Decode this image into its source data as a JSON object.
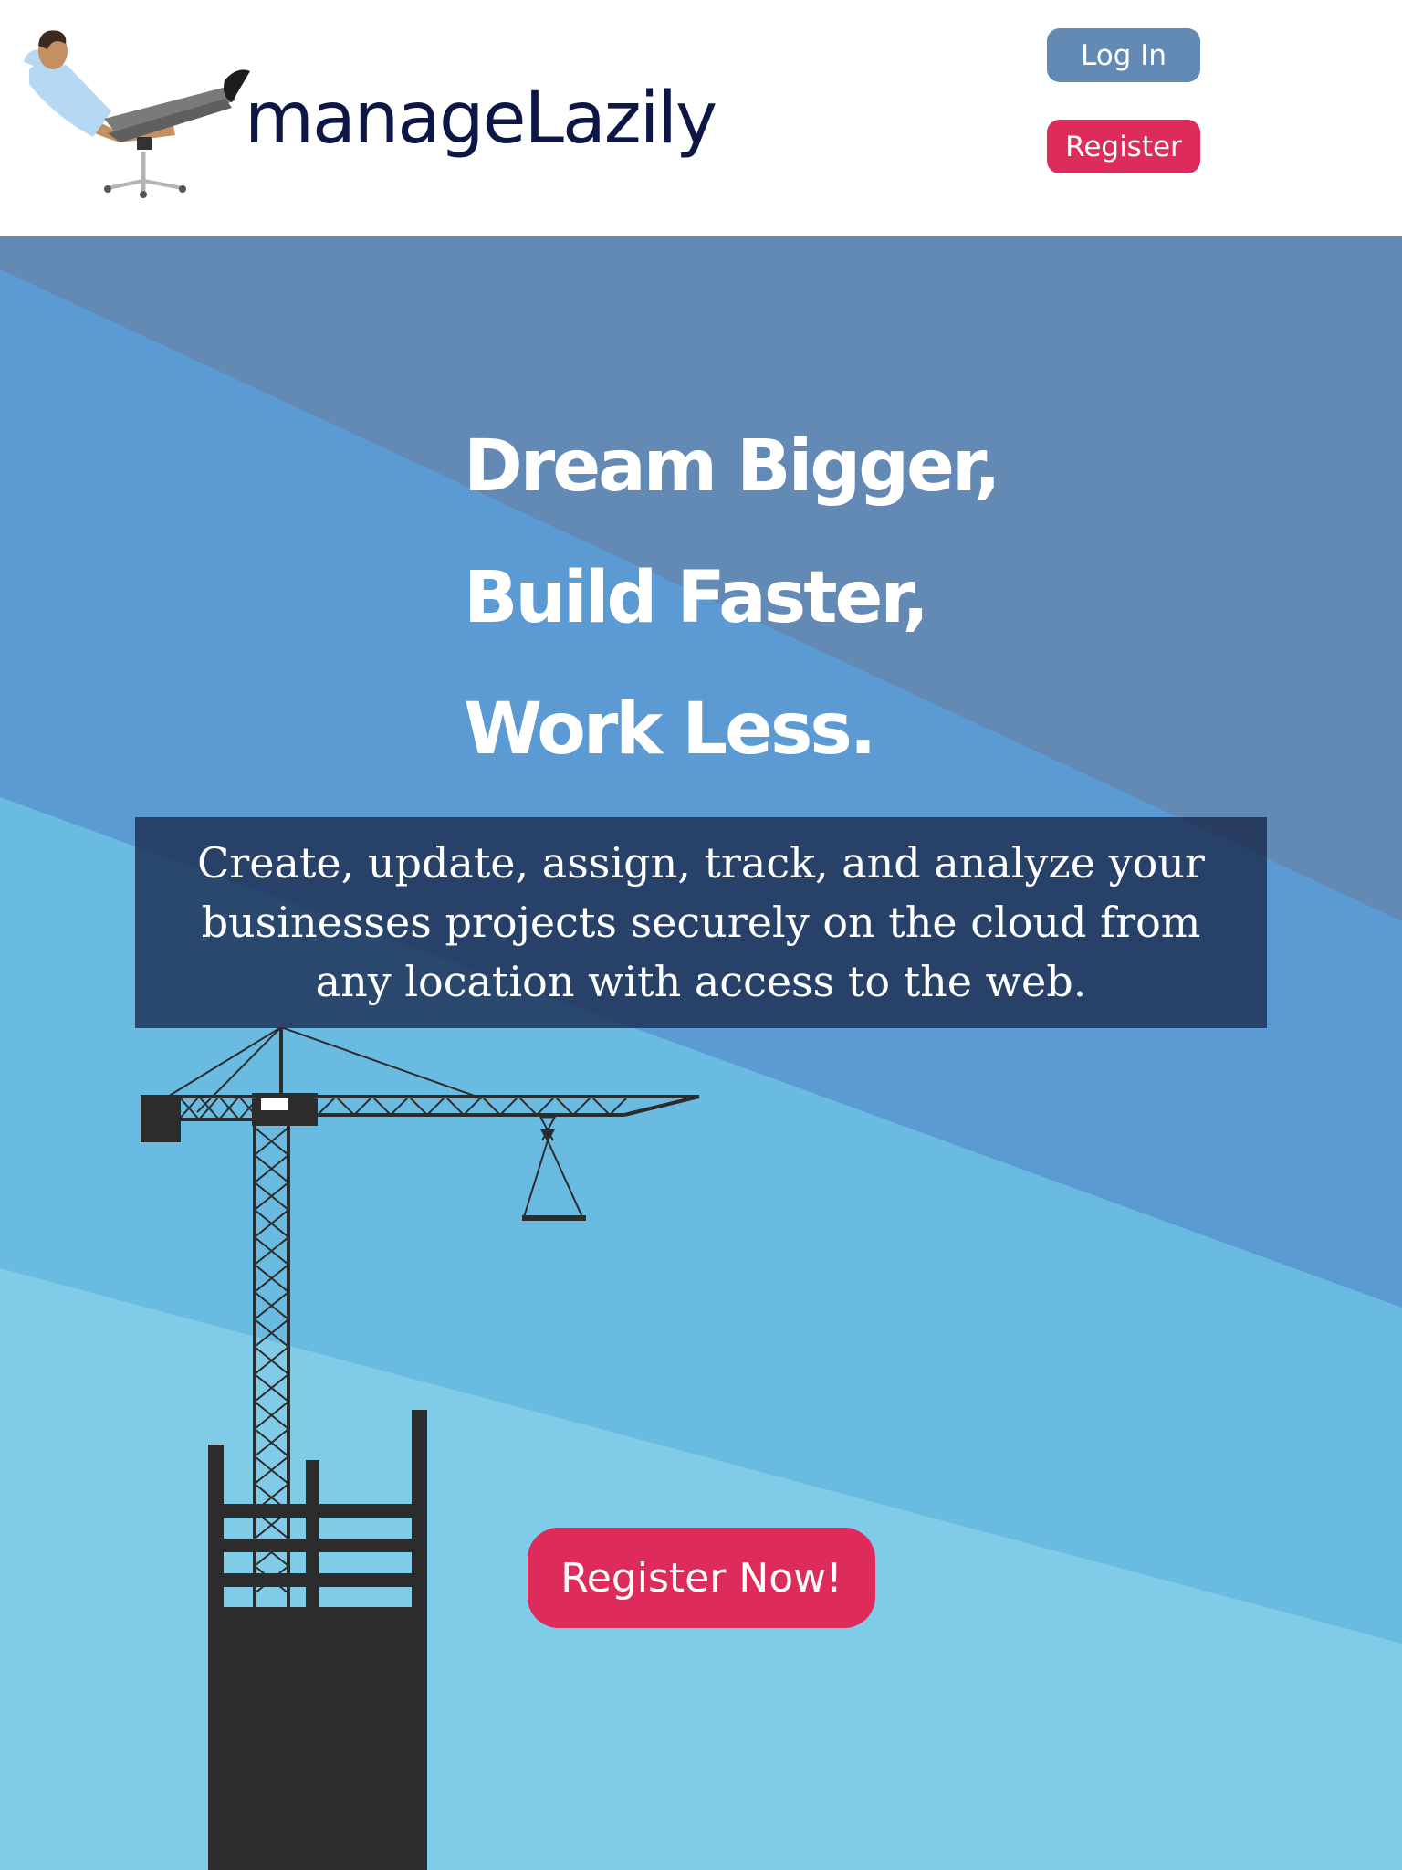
{
  "header": {
    "logo_text": "manageLazily",
    "login_label": "Log In",
    "register_label": "Register"
  },
  "hero": {
    "headline": [
      "Dream Bigger,",
      "Build Faster,",
      "Work Less."
    ],
    "tagline": "Create, update, assign, track, and analyze your businesses projects securely on the cloud from any location with access to the web.",
    "cta_label": "Register Now!"
  },
  "colors": {
    "brand_navy": "#0c1746",
    "login_button": "#6389b5",
    "register_button": "#dd2b5c",
    "hero_top": "#6389b5",
    "hero_mid": "#5b9ad3",
    "hero_light": "#6abbe2",
    "hero_lightest": "#7fcbe8",
    "tagline_box": "#18284c",
    "crane": "#2c2c2c"
  },
  "icons": {
    "logo_figure": "relaxing-man-in-chair-icon",
    "crane": "construction-crane-building"
  }
}
